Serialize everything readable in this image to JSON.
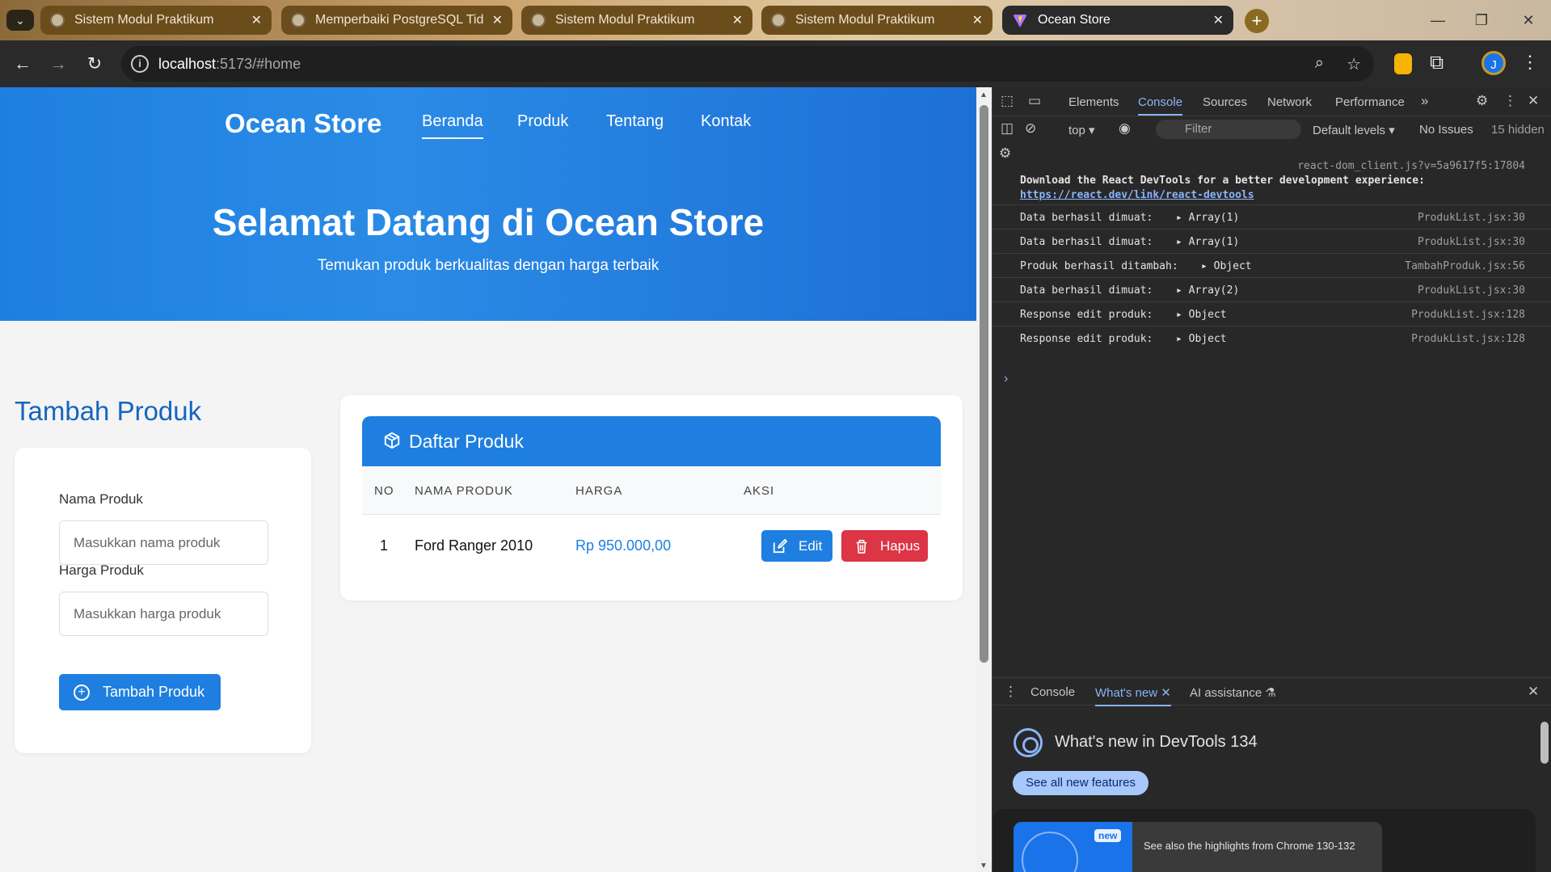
{
  "browser": {
    "tabs": [
      {
        "title": "Sistem Modul Praktikum",
        "active": false
      },
      {
        "title": "Memperbaiki PostgreSQL Tidak",
        "active": false
      },
      {
        "title": "Sistem Modul Praktikum",
        "active": false
      },
      {
        "title": "Sistem Modul Praktikum",
        "active": false
      },
      {
        "title": "Ocean Store",
        "active": true
      }
    ],
    "url_host": "localhost",
    "url_rest": ":5173/#home",
    "profile_initial": "J"
  },
  "site": {
    "brand": "Ocean Store",
    "nav": [
      "Beranda",
      "Produk",
      "Tentang",
      "Kontak"
    ],
    "active_nav": "Beranda",
    "hero_title": "Selamat Datang di Ocean Store",
    "hero_subtitle": "Temukan produk berkualitas dengan harga terbaik",
    "accent_color": "#1e7fe0",
    "danger_color": "#dc3545"
  },
  "form": {
    "title": "Tambah Produk",
    "name_label": "Nama Produk",
    "name_placeholder": "Masukkan nama produk",
    "price_label": "Harga Produk",
    "price_placeholder": "Masukkan harga produk",
    "submit_label": "Tambah Produk"
  },
  "product_list": {
    "title": "Daftar Produk",
    "columns": [
      "NO",
      "NAMA PRODUK",
      "HARGA",
      "AKSI"
    ],
    "rows": [
      {
        "no": "1",
        "name": "Ford Ranger 2010",
        "price": "Rp 950.000,00"
      }
    ],
    "edit_label": "Edit",
    "delete_label": "Hapus"
  },
  "devtools": {
    "tabs": [
      "Elements",
      "Console",
      "Sources",
      "Network",
      "Performance"
    ],
    "active_tab": "Console",
    "context": "top",
    "filter_placeholder": "Filter",
    "levels": "Default levels",
    "issues": "No Issues",
    "hidden": "15 hidden",
    "logs_header": {
      "source": "react-dom_client.js?v=5a9617f5:17804",
      "message": "Download the React DevTools for a better development experience:",
      "link": "https://react.dev/link/react-devtools"
    },
    "logs": [
      {
        "message": "Data berhasil dimuat:",
        "object": "Array(1)",
        "source": "ProdukList.jsx:30"
      },
      {
        "message": "Data berhasil dimuat:",
        "object": "Array(1)",
        "source": "ProdukList.jsx:30"
      },
      {
        "message": "Produk berhasil ditambah:",
        "object": "Object",
        "source": "TambahProduk.jsx:56"
      },
      {
        "message": "Data berhasil dimuat:",
        "object": "Array(2)",
        "source": "ProdukList.jsx:30"
      },
      {
        "message": "Response edit produk:",
        "object": "Object",
        "source": "ProdukList.jsx:128"
      },
      {
        "message": "Response edit produk:",
        "object": "Object",
        "source": "ProdukList.jsx:128"
      }
    ],
    "drawer_tabs": [
      "Console",
      "What's new",
      "AI assistance"
    ],
    "drawer_active": "What's new",
    "whats_new_title": "What's new in DevTools 134",
    "see_all_label": "See all new features",
    "new_badge": "new",
    "highlights_text": "See also the highlights from Chrome 130-132"
  }
}
